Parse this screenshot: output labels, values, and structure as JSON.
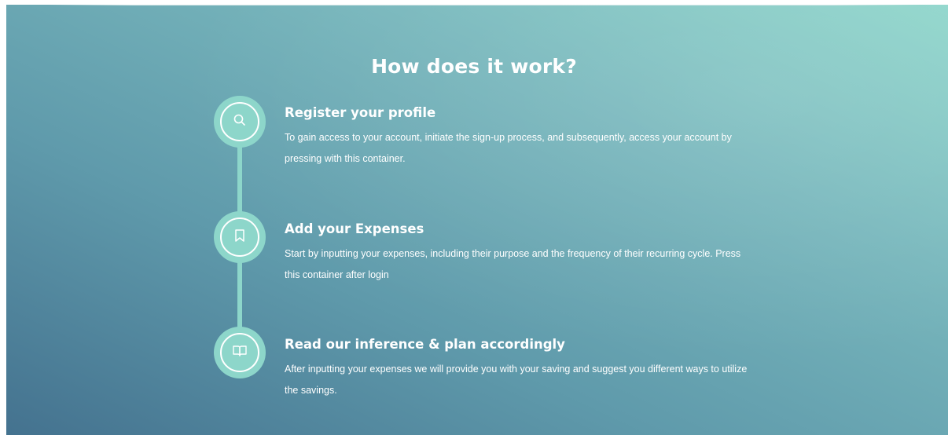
{
  "section": {
    "heading": "How does it work?"
  },
  "steps": [
    {
      "icon": "search-icon",
      "title": "Register your profile",
      "description": "To gain access to your account, initiate the sign-up process, and subsequently, access your account by pressing with this container."
    },
    {
      "icon": "bookmark-icon",
      "title": "Add your Expenses",
      "description": "Start by inputting your expenses, including their purpose and the frequency of their recurring cycle. Press this container after login"
    },
    {
      "icon": "book-icon",
      "title": "Read our inference & plan accordingly",
      "description": "After inputting your expenses we will provide you with your saving and suggest you different ways to utilize the savings."
    }
  ],
  "colors": {
    "accent": "#8dd6ca",
    "gradient_top_right": "#8fd6cb",
    "gradient_bottom_left": "#44728f",
    "text": "#ffffff"
  }
}
